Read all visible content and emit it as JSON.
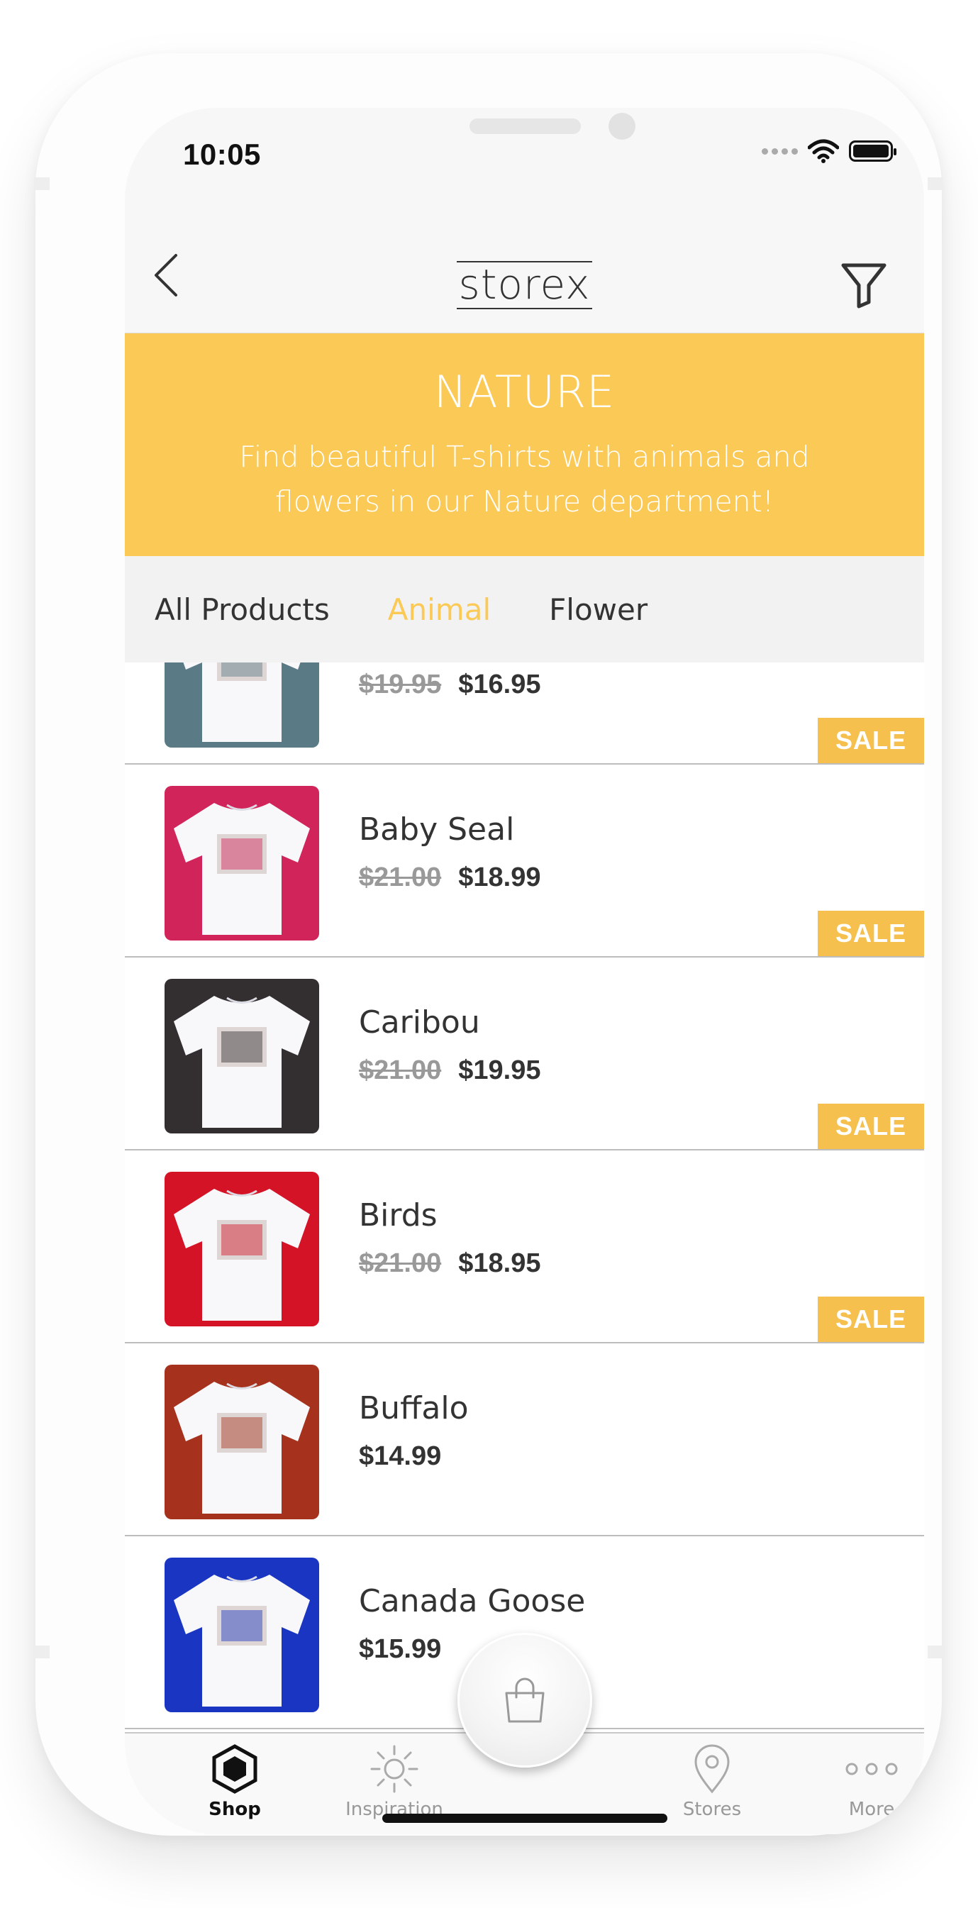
{
  "status_bar": {
    "time": "10:05"
  },
  "nav": {
    "logo": "storex"
  },
  "banner": {
    "title": "NATURE",
    "subtitle": "Find beautiful T-shirts with animals and flowers in our Nature department!",
    "background": "#fbc956"
  },
  "category_tabs": [
    {
      "label": "All Products",
      "active": false
    },
    {
      "label": "Animal",
      "active": true
    },
    {
      "label": "Flower",
      "active": false
    }
  ],
  "sale_badge": "SALE",
  "products": [
    {
      "name": "",
      "old_price": "$19.95",
      "price": "$16.95",
      "sale": true,
      "shirt_bg": "#5a7a86"
    },
    {
      "name": "Baby Seal",
      "old_price": "$21.00",
      "price": "$18.99",
      "sale": true,
      "shirt_bg": "#d1245a"
    },
    {
      "name": "Caribou",
      "old_price": "$21.00",
      "price": "$19.95",
      "sale": true,
      "shirt_bg": "#332e30"
    },
    {
      "name": "Birds",
      "old_price": "$21.00",
      "price": "$18.95",
      "sale": true,
      "shirt_bg": "#d41327"
    },
    {
      "name": "Buffalo",
      "old_price": "",
      "price": "$14.99",
      "sale": false,
      "shirt_bg": "#a6321e"
    },
    {
      "name": "Canada Goose",
      "old_price": "",
      "price": "$15.99",
      "sale": false,
      "shirt_bg": "#1a35c2"
    }
  ],
  "tab_bar": [
    {
      "label": "Shop",
      "icon": "hexagon-icon",
      "active": true
    },
    {
      "label": "Inspiration",
      "icon": "sun-icon",
      "active": false
    },
    {
      "label": "Stores",
      "icon": "location-pin-icon",
      "active": false
    },
    {
      "label": "More",
      "icon": "more-dots-icon",
      "active": false
    }
  ],
  "colors": {
    "accent": "#fbc956",
    "sale": "#f6c04f"
  }
}
